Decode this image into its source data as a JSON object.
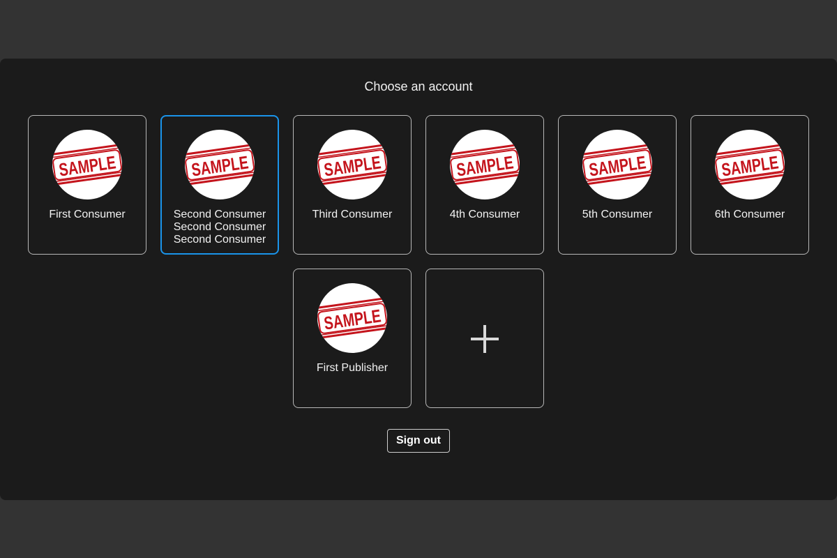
{
  "dialog": {
    "title": "Choose an account",
    "accent_color": "#1a94ea",
    "avatar_stamp_text": "SAMPLE",
    "avatar_icon": "sample-stamp-icon",
    "add_icon": "plus-icon"
  },
  "accounts": [
    {
      "label": "First Consumer",
      "selected": false
    },
    {
      "label": "Second Consumer Second Consumer Second Consumer",
      "selected": true
    },
    {
      "label": "Third Consumer",
      "selected": false
    },
    {
      "label": "4th Consumer",
      "selected": false
    },
    {
      "label": "5th Consumer",
      "selected": false
    },
    {
      "label": "6th Consumer",
      "selected": false
    },
    {
      "label": "First Publisher",
      "selected": false
    }
  ],
  "actions": {
    "sign_out_label": "Sign out"
  }
}
